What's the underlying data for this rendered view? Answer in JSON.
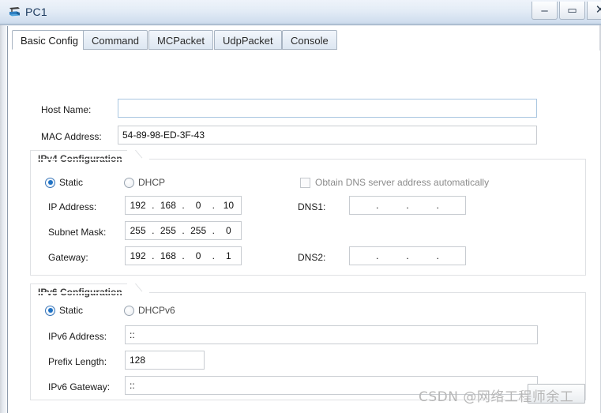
{
  "window": {
    "title": "PC1",
    "icon": "pc-device-icon",
    "controls": [
      {
        "name": "minimize",
        "glyph": "–"
      },
      {
        "name": "maximize",
        "glyph": "▭"
      },
      {
        "name": "close",
        "glyph": "✕"
      }
    ]
  },
  "tabs": [
    {
      "label": "Basic Config",
      "active": true
    },
    {
      "label": "Command",
      "active": false
    },
    {
      "label": "MCPacket",
      "active": false
    },
    {
      "label": "UdpPacket",
      "active": false
    },
    {
      "label": "Console",
      "active": false
    }
  ],
  "basic_config": {
    "host_name": {
      "label": "Host Name:",
      "value": "",
      "placeholder": ""
    },
    "mac_address": {
      "label": "MAC Address:",
      "value": "54-89-98-ED-3F-43"
    }
  },
  "ipv4": {
    "group_title": "IPv4 Configuration",
    "mode_static": {
      "label": "Static",
      "selected": true
    },
    "mode_dhcp": {
      "label": "DHCP",
      "selected": false
    },
    "ip_address": {
      "label": "IP Address:",
      "octets": [
        "192",
        "168",
        "0",
        "10"
      ]
    },
    "subnet_mask": {
      "label": "Subnet Mask:",
      "octets": [
        "255",
        "255",
        "255",
        "0"
      ]
    },
    "gateway": {
      "label": "Gateway:",
      "octets": [
        "192",
        "168",
        "0",
        "1"
      ]
    },
    "obtain_dns_auto": {
      "label": "Obtain DNS server address automatically",
      "checked": false
    },
    "dns1": {
      "label": "DNS1:",
      "octets": [
        "",
        "",
        "",
        ""
      ]
    },
    "dns2": {
      "label": "DNS2:",
      "octets": [
        "",
        "",
        "",
        ""
      ]
    }
  },
  "ipv6": {
    "group_title": "IPv6 Configuration",
    "mode_static": {
      "label": "Static",
      "selected": true
    },
    "mode_dhcpv6": {
      "label": "DHCPv6",
      "selected": false
    },
    "ipv6_address": {
      "label": "IPv6 Address:",
      "value": "::"
    },
    "prefix_length": {
      "label": "Prefix Length:",
      "value": "128"
    },
    "ipv6_gateway": {
      "label": "IPv6 Gateway:",
      "value": "::"
    }
  },
  "footer": {
    "apply_button_label": "",
    "watermark": "CSDN @网络工程师余工"
  },
  "colors": {
    "titlebar_start": "#eef3fa",
    "titlebar_end": "#b9c9db",
    "title_text": "#1c3a5e",
    "tab_border": "#a8b4c2",
    "radio_accent": "#1f72c4",
    "field_border": "#c8ccd1",
    "group_border": "#dfe1e4",
    "watermark": "#b7b7b7"
  }
}
